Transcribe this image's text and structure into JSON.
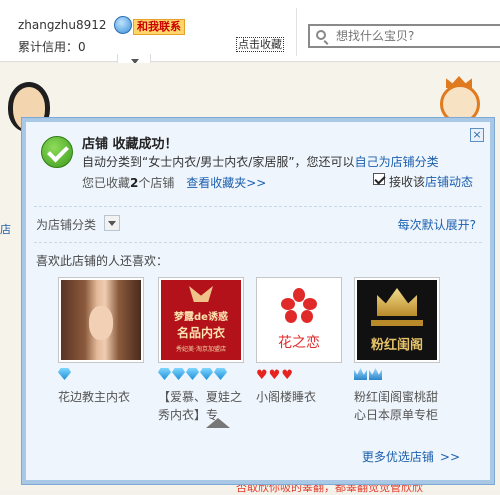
{
  "header": {
    "seller_name": "zhangzhu8912",
    "contact_label": "和我联系",
    "credit_label": "累计信用：0",
    "favorite_label": "点击收藏",
    "search_placeholder": "想找什么宝贝?"
  },
  "background": {
    "side_text": "店",
    "bottom_text": "否取欣你吸的睾翻，都睾翻觉觉管欣欣"
  },
  "modal": {
    "close_label": "×",
    "title": "店铺 收藏成功！",
    "auto_prefix": "自动分类到",
    "auto_category": "“女士内衣/男士内衣/家居服”",
    "auto_middle": "，您还可以",
    "category_link": "自己为店铺分类",
    "count_prefix": "您已收藏",
    "count_value": "2",
    "count_suffix": "个店铺",
    "view_link": "查看收藏夹",
    "view_arrow": ">>",
    "receive_prefix": "接收该",
    "receive_link": "店铺动态",
    "receive_checked": true,
    "category_label": "为店铺分类",
    "expand_link": "每次默认展开?",
    "also_like_label": "喜欢此店铺的人还喜欢：",
    "more_link": "更多优选店铺",
    "more_arrow": ">>"
  },
  "shops": [
    {
      "name": "花边教主内衣",
      "rating": {
        "type": "gem",
        "count": 1
      },
      "thumb_title": "",
      "thumb_sub": ""
    },
    {
      "name": "【爱慕、夏娃之秀内衣】专",
      "rating": {
        "type": "gem",
        "count": 5
      },
      "thumb_title": "梦露de诱惑",
      "thumb_title2": "名品内衣",
      "thumb_sub": "秀妃美·淘京加盟店"
    },
    {
      "name": "小阁楼睡衣",
      "rating": {
        "type": "heart",
        "count": 3
      },
      "thumb_title": "花之恋"
    },
    {
      "name": "粉红闺阁蜜桃甜心日本原单专柜",
      "rating": {
        "type": "crown",
        "count": 2
      },
      "thumb_title": "粉红闺阁"
    }
  ],
  "colors": {
    "link": "#1c5fae",
    "modal_bg": "#eef5fc",
    "modal_border": "#a9c8e6",
    "heart": "#e8231f",
    "contact_bg": "#ffd56b"
  }
}
